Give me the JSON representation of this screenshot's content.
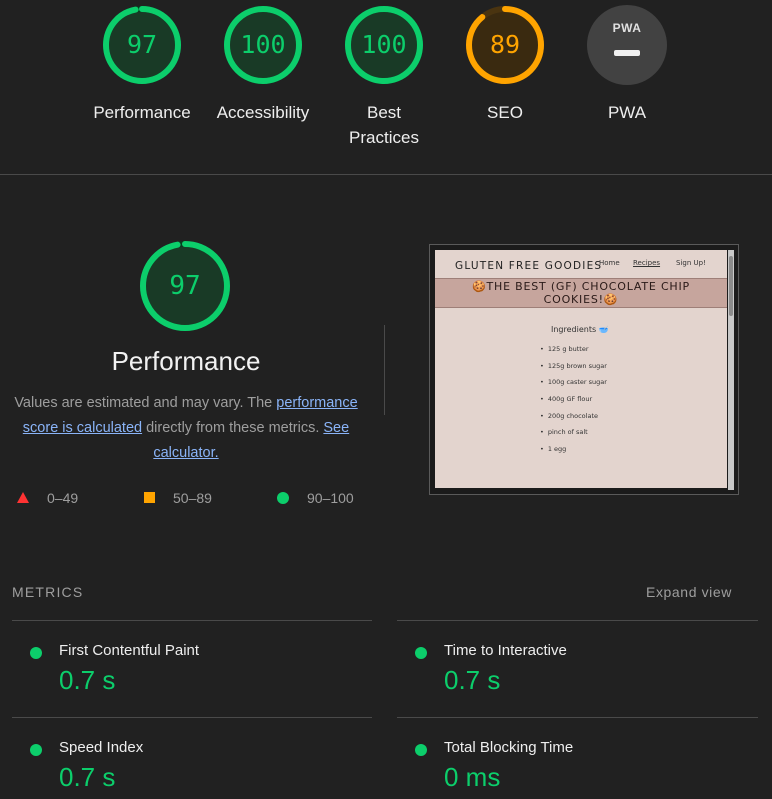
{
  "gauges": [
    {
      "score": "97",
      "label": "Performance",
      "fraction": 0.97,
      "color": "#0cce6b"
    },
    {
      "score": "100",
      "label": "Accessibility",
      "fraction": 1.0,
      "color": "#0cce6b"
    },
    {
      "score": "100",
      "label_line1": "Best",
      "label_line2": "Practices",
      "fraction": 1.0,
      "color": "#0cce6b"
    },
    {
      "score": "89",
      "label": "SEO",
      "fraction": 0.89,
      "color": "#ffa400"
    },
    {
      "badge": "PWA",
      "label": "PWA"
    }
  ],
  "performance": {
    "score": "97",
    "fraction": 0.97,
    "title": "Performance",
    "desc_part1": "Values are estimated and may vary. The ",
    "desc_link1": "performance score is calculated",
    "desc_part2": " directly from these metrics. ",
    "desc_link2": "See calculator.",
    "legend": {
      "fail": "0–49",
      "average": "50–89",
      "pass": "90–100"
    }
  },
  "screenshot": {
    "site_title": "GLUTEN FREE GOODIES",
    "nav": [
      "Home",
      "Recipes",
      "Sign Up!"
    ],
    "banner_line1": "🍪THE BEST (GF) CHOCOLATE CHIP",
    "banner_line2": "COOKIES!🍪",
    "ingredients_title": "Ingredients 🥣",
    "ingredients": [
      "125 g butter",
      "125g brown sugar",
      "100g caster sugar",
      "400g GF flour",
      "200g chocolate",
      "pinch of salt",
      "1 egg"
    ]
  },
  "metrics": {
    "heading": "METRICS",
    "expand_label": "Expand view",
    "items": [
      {
        "name": "First Contentful Paint",
        "value": "0.7 s"
      },
      {
        "name": "Time to Interactive",
        "value": "0.7 s"
      },
      {
        "name": "Speed Index",
        "value": "0.7 s"
      },
      {
        "name": "Total Blocking Time",
        "value": "0 ms"
      }
    ]
  },
  "colors": {
    "pass": "#0cce6b",
    "average": "#ffa400",
    "fail": "#ff3333",
    "background": "#212121"
  }
}
